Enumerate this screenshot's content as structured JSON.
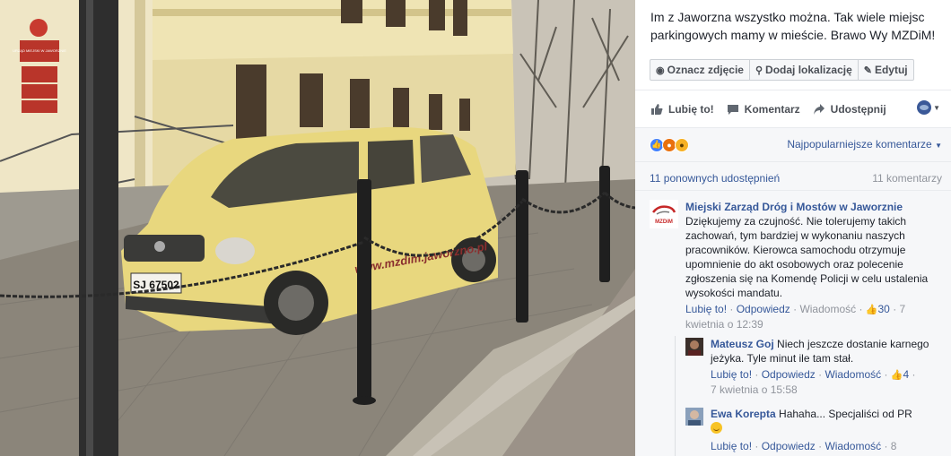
{
  "post": {
    "caption": "Im z Jaworzna wszystko można. Tak wiele miejsc parkingowych mamy w mieście. Brawo Wy MZDiM!"
  },
  "photo": {
    "sign_text": "URZĄD MIEJSKI W JAWORZNIE",
    "plate_text": "SJ 67502",
    "door_text": "www.mzdim.jaworzno.pl"
  },
  "toolbar": {
    "tag_label": "Oznacz zdjęcie",
    "location_label": "Dodaj lokalizację",
    "edit_label": "Edytuj"
  },
  "actions": {
    "like_label": "Lubię to!",
    "comment_label": "Komentarz",
    "share_label": "Udostępnij"
  },
  "reactions": {
    "sort_label": "Najpopularniejsze komentarze",
    "shares_text": "11 ponownych udostępnień",
    "comments_count_text": "11 komentarzy"
  },
  "comments": [
    {
      "author": "Miejski Zarząd Dróg i Mostów w Jaworznie",
      "text": "Dziękujemy za czujność. Nie tolerujemy takich zachowań, tym bardziej w wykonaniu naszych pracowników. Kierowca samochodu otrzymuje upomnienie do akt osobowych oraz polecenie zgłoszenia się na Komendę Policji w celu ustalenia wysokości mandatu.",
      "like_link": "Lubię to!",
      "reply_link": "Odpowiedz",
      "message_link": "Wiadomość",
      "likes": "30",
      "date": "7 kwietnia o 12:39",
      "avatar_text": "MZDiM"
    },
    {
      "author": "Mateusz Goj",
      "text": "Niech jeszcze dostanie karnego jeżyka. Tyle minut ile tam stał.",
      "like_link": "Lubię to!",
      "reply_link": "Odpowiedz",
      "message_link": "Wiadomość",
      "likes": "4",
      "date": "7 kwietnia o 15:58"
    },
    {
      "author": "Ewa Korepta",
      "text": "Hahaha... Specjaliści od PR",
      "like_link": "Lubię to!",
      "reply_link": "Odpowiedz",
      "message_link": "Wiadomość",
      "date_partial": "8"
    }
  ],
  "colors": {
    "link": "#365899",
    "meta": "#90949c",
    "panel_bg": "#f6f7f9",
    "car": "#e8d77e"
  },
  "icons": [
    "tag-icon",
    "pin-icon",
    "pencil-icon",
    "like-icon",
    "comment-icon",
    "share-icon",
    "globe-icon",
    "chevron-down-icon"
  ]
}
